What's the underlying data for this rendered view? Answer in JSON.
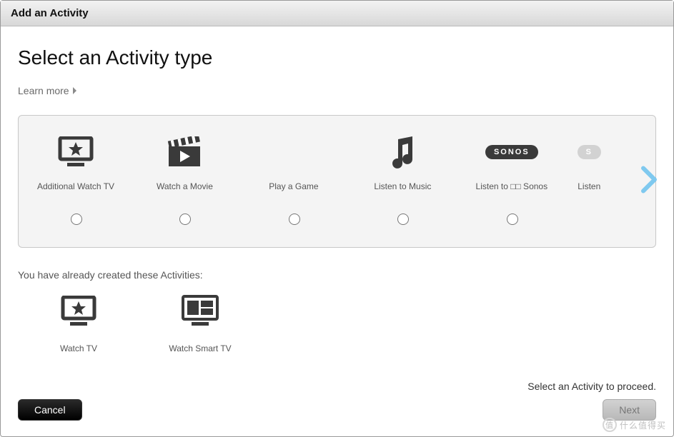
{
  "titlebar": "Add an Activity",
  "page": {
    "heading": "Select an Activity type",
    "learn_more": "Learn more",
    "already_label": "You have already created these Activities:",
    "proceed_hint": "Select an Activity to proceed."
  },
  "activities": [
    {
      "id": "additional-watch-tv",
      "label": "Additional Watch TV",
      "icon": "tv-star"
    },
    {
      "id": "watch-a-movie",
      "label": "Watch a Movie",
      "icon": "clapper"
    },
    {
      "id": "play-a-game",
      "label": "Play a Game",
      "icon": "none"
    },
    {
      "id": "listen-to-music",
      "label": "Listen to Music",
      "icon": "music-note"
    },
    {
      "id": "listen-to-sonos",
      "label": "Listen to □□ Sonos",
      "icon": "sonos"
    },
    {
      "id": "listen-partial",
      "label": "Listen",
      "icon": "sonos-ghost"
    }
  ],
  "existing": [
    {
      "id": "watch-tv",
      "label": "Watch TV",
      "icon": "tv-star"
    },
    {
      "id": "watch-smart-tv",
      "label": "Watch Smart TV",
      "icon": "tv-grid"
    }
  ],
  "buttons": {
    "cancel": "Cancel",
    "next": "Next"
  },
  "watermark": {
    "badge": "值",
    "text": "什么值得买"
  }
}
